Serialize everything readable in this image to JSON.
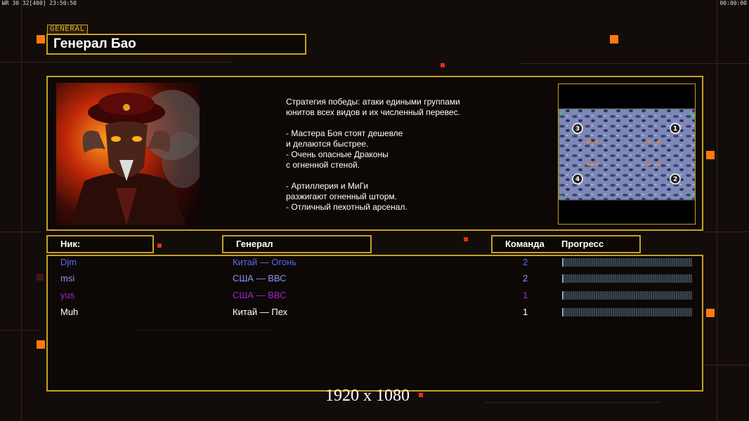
{
  "hud": {
    "left": "ЫR 30 32[400] 23:50:50",
    "right": "00:00:00"
  },
  "general": {
    "tag": "GENERAL",
    "name": "Генерал Бао",
    "description": "Стратегия победы: атаки едиными группами\nюнитов всех видов и их численный перевес.\n\n- Мастера Боя стоят дешевле\nи делаются быстрее.\n- Очень опасные Драконы\nс огненной стеной.\n\n- Артиллерия и МиГи\nразжигают огненный шторм.\n- Отличный пехотный арсенал."
  },
  "minimap": {
    "start_positions": [
      "1",
      "2",
      "3",
      "4"
    ]
  },
  "table": {
    "headers": {
      "nick": "Ник:",
      "general": "Генерал",
      "team": "Команда",
      "progress": "Прогресс"
    },
    "rows": [
      {
        "nick": "Djm",
        "general": "Китай — Огонь",
        "team": "2",
        "progress": 0.01,
        "color": "#5a6cf0"
      },
      {
        "nick": "msi",
        "general": "США — ВВС",
        "team": "2",
        "progress": 0.01,
        "color": "#8a96ff"
      },
      {
        "nick": "yus",
        "general": "США — ВВС",
        "team": "1",
        "progress": 0.01,
        "color": "#9a28c8"
      },
      {
        "nick": "Muh",
        "general": "Китай — Пех",
        "team": "1",
        "progress": 0.01,
        "color": "#ffffff"
      }
    ]
  },
  "resolution": "1920 x 1080",
  "colors": {
    "frame": "#c8a020",
    "accent": "#ff7a10",
    "background": "#120d0a"
  }
}
